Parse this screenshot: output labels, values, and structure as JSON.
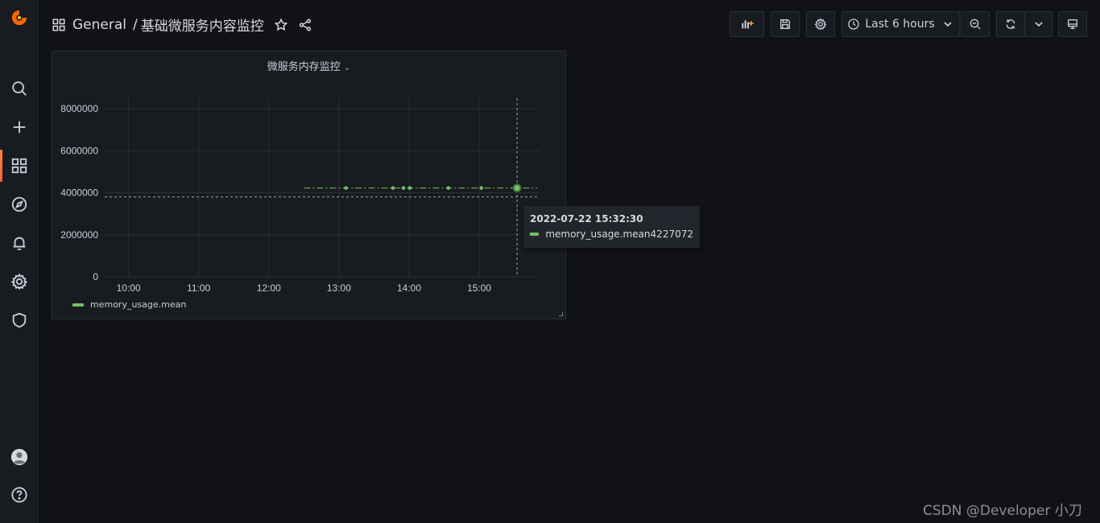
{
  "breadcrumb": {
    "folder": "General",
    "separator": "/",
    "dashboard": "基础微服务内容监控"
  },
  "toolbar": {
    "time_range": "Last 6 hours"
  },
  "panel": {
    "title": "微服务内存监控"
  },
  "chart_data": {
    "type": "line",
    "x_ticks": [
      "10:00",
      "11:00",
      "12:00",
      "13:00",
      "14:00",
      "15:00"
    ],
    "y_ticks": [
      "0",
      "2000000",
      "4000000",
      "6000000",
      "8000000"
    ],
    "ylim": [
      0,
      8500000
    ],
    "xlim_hours": [
      9.66,
      15.86
    ],
    "series": [
      {
        "name": "memory_usage.mean",
        "color": "#73bf69",
        "style": "dashed",
        "points": [
          {
            "t": 12.5,
            "v": 4227072
          },
          {
            "t": 13.1,
            "v": 4227072
          },
          {
            "t": 13.77,
            "v": 4227072
          },
          {
            "t": 13.92,
            "v": 4227072
          },
          {
            "t": 14.01,
            "v": 4227072
          },
          {
            "t": 14.56,
            "v": 4227072
          },
          {
            "t": 15.03,
            "v": 4227072
          },
          {
            "t": 15.54,
            "v": 4227072
          },
          {
            "t": 15.83,
            "v": 4227072
          }
        ],
        "markers": [
          13.1,
          13.77,
          13.92,
          14.01,
          14.56,
          15.03,
          15.54
        ]
      }
    ],
    "hover_time": 15.54,
    "hover_value": 3800000,
    "grid": true,
    "legend": "bottom-left"
  },
  "tooltip": {
    "time": "2022-07-22 15:32:30",
    "series": "memory_usage.mean",
    "value": "4227072"
  },
  "watermark": "CSDN @Developer 小刀",
  "icons": [
    "grafana-logo-icon",
    "search-icon",
    "plus-icon",
    "dashboards-icon",
    "explore-icon",
    "alert-bell-icon",
    "gear-icon",
    "shield-icon",
    "avatar-icon",
    "help-icon"
  ]
}
